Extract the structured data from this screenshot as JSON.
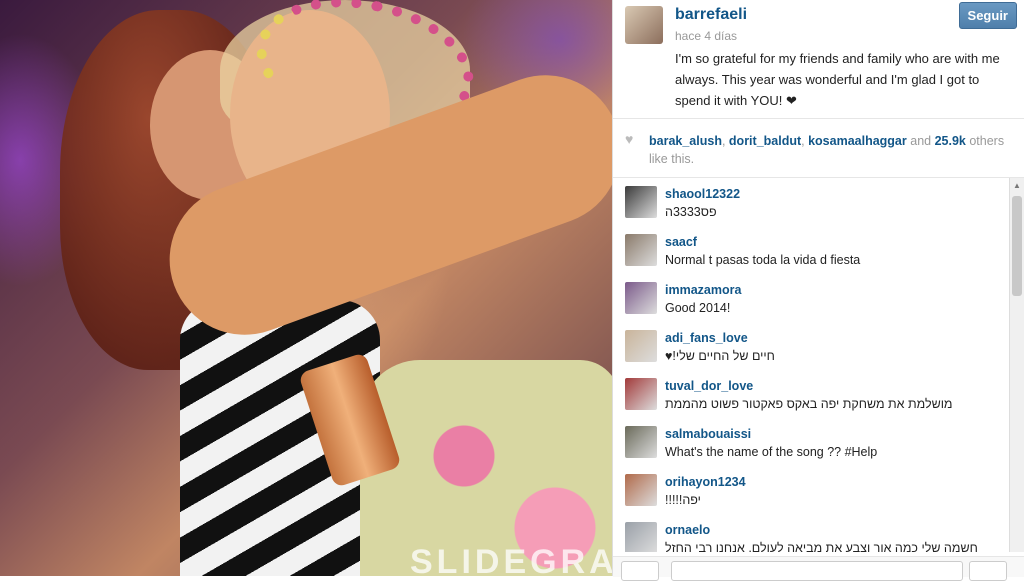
{
  "post": {
    "username": "barrefaeli",
    "timestamp": "hace 4 días",
    "follow_label": "Seguir",
    "caption": "I'm so grateful for my friends and family who are with me always. This year was wonderful and I'm glad I got to spend it with YOU! ❤",
    "watermark": "SLIDEGRAM"
  },
  "likes": {
    "users": [
      "barak_alush",
      "dorit_baldut",
      "kosamaalhaggar"
    ],
    "count": "25.9k",
    "suffix": "others like this."
  },
  "comments": [
    {
      "user": "shaool12322",
      "text": "פס3333ה",
      "avatar_color": "#3a3a3a"
    },
    {
      "user": "saacf",
      "text": "Normal t pasas toda la vida d fiesta",
      "avatar_color": "#8a7a6a"
    },
    {
      "user": "immazamora",
      "text": "Good 2014!",
      "avatar_color": "#7b5a8a"
    },
    {
      "user": "adi_fans_love",
      "text": "♥!חיים של החיים שלי",
      "avatar_color": "#c9b49a"
    },
    {
      "user": "tuval_dor_love",
      "text": "מושלמת את משחקת יפה באקס פאקטור פשוט מהממת",
      "avatar_color": "#a23a3a"
    },
    {
      "user": "salmabouaissi",
      "text": "What's the name of the song ?? #Help",
      "avatar_color": "#6a6a5a"
    },
    {
      "user": "orihayon1234",
      "text": "!!!!!יפה",
      "avatar_color": "#b06a4a"
    },
    {
      "user": "ornaelo",
      "text": "חשמה שלי כמה אור וצבע את מביאה לעולם, אנחנו רבי החזל",
      "avatar_color": "#9aa0a8"
    }
  ]
}
